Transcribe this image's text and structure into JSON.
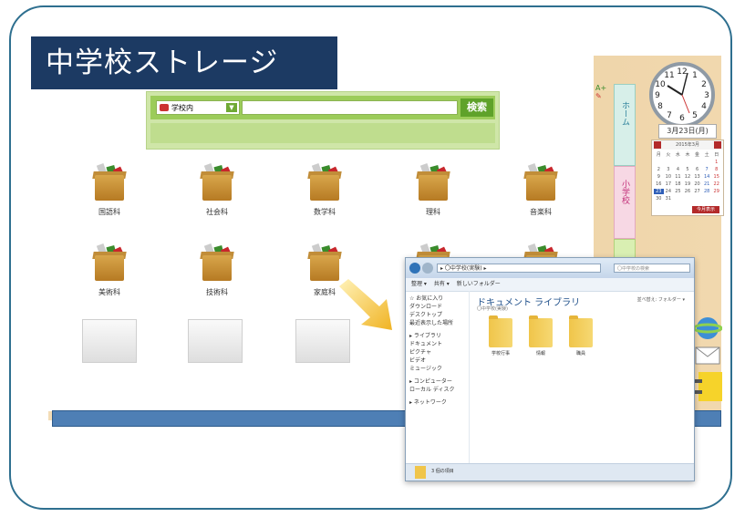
{
  "title": "中学校ストレージ",
  "search": {
    "scope_label": "学校内",
    "button_label": "検索"
  },
  "subjects": [
    "国語科",
    "社会科",
    "数学科",
    "理科",
    "音楽科",
    "美術科",
    "技術科",
    "家庭科"
  ],
  "side_tabs": {
    "home_label": "ホーム",
    "elementary_label": "小学校"
  },
  "clock": {
    "numbers": [
      "12",
      "1",
      "2",
      "3",
      "4",
      "5",
      "6",
      "7",
      "8",
      "9",
      "10",
      "11"
    ]
  },
  "date_label": "3月23日(月)",
  "calendar": {
    "header": "2015年3月",
    "weekdays": [
      "月",
      "火",
      "水",
      "木",
      "金",
      "土",
      "日"
    ],
    "days": [
      "",
      "",
      "",
      "",
      "",
      "",
      "1",
      "2",
      "3",
      "4",
      "5",
      "6",
      "7",
      "8",
      "9",
      "10",
      "11",
      "12",
      "13",
      "14",
      "15",
      "16",
      "17",
      "18",
      "19",
      "20",
      "21",
      "22",
      "23",
      "24",
      "25",
      "26",
      "27",
      "28",
      "29",
      "30",
      "31"
    ],
    "button_label": "今月表示"
  },
  "explorer": {
    "address": "▸ 〇中学校(実験) ▸",
    "search_placeholder": "〇中学校の検索",
    "toolbar": [
      "整理 ▾",
      "共有 ▾",
      "新しいフォルダー"
    ],
    "nav": [
      "☆ お気に入り",
      "  ダウンロード",
      "  デスクトップ",
      "  最近表示した場所",
      "",
      "▸ ライブラリ",
      "  ドキュメント",
      "  ピクチャ",
      "  ビデオ",
      "  ミュージック",
      "",
      "▸ コンピューター",
      "  ローカル ディスク",
      "",
      "▸ ネットワーク"
    ],
    "library_title": "ドキュメント ライブラリ",
    "library_sub": "〇中学校(実験)",
    "arrange": "並べ替え: フォルダー ▾",
    "folders": [
      "学校行事",
      "情報",
      "職員"
    ],
    "status": "3 個の項目"
  },
  "colors": {
    "title_bg": "#1c3a63",
    "search_green": "#9ccc5a",
    "blue_bar": "#4e7fb5"
  }
}
